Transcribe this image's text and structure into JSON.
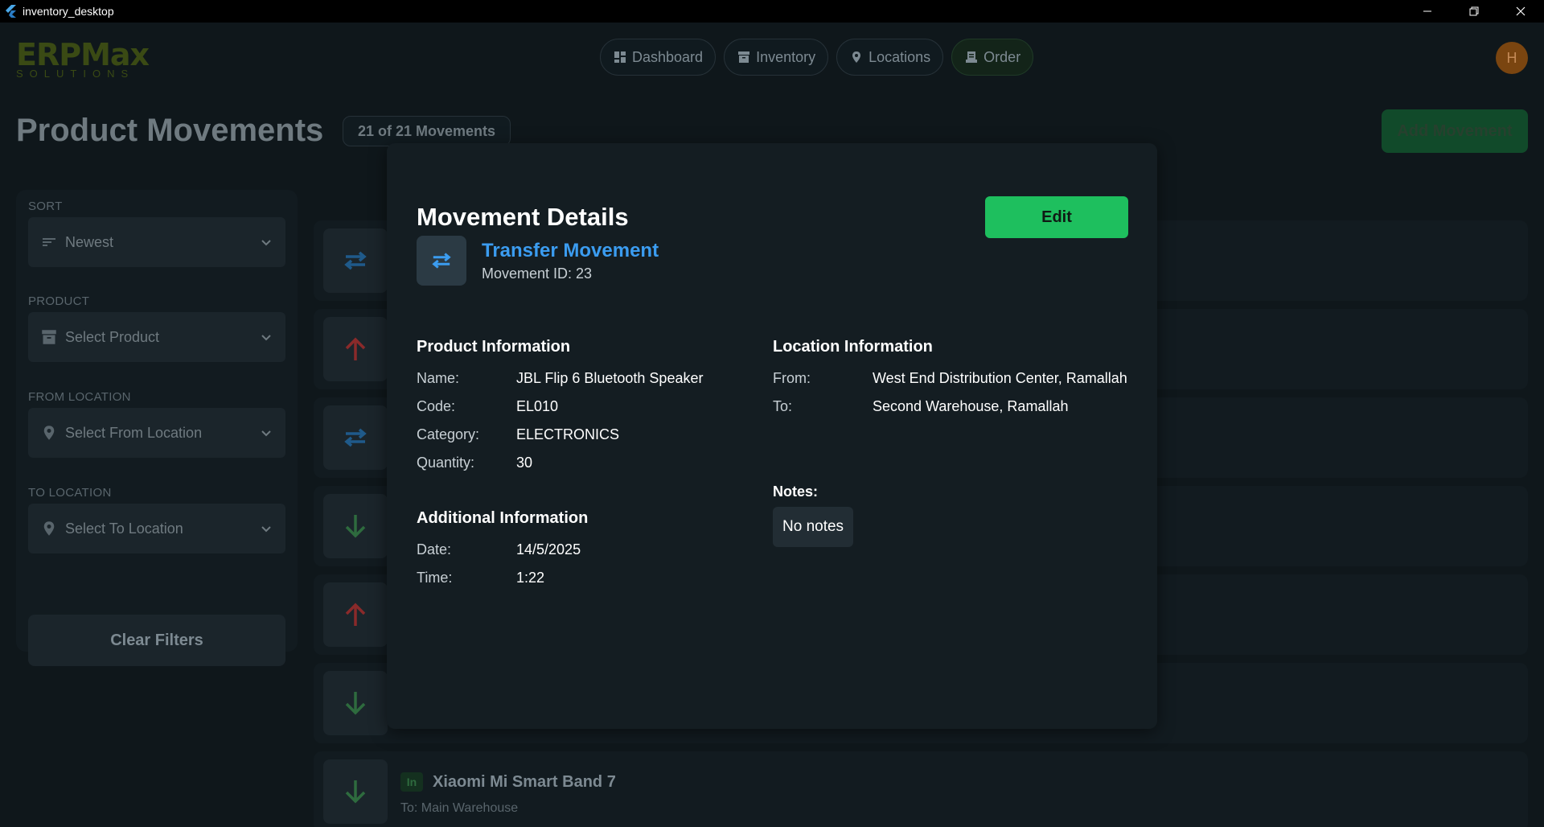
{
  "window": {
    "title": "inventory_desktop"
  },
  "logo": {
    "main": "ERPMax",
    "sub": "SOLUTIONS"
  },
  "nav": {
    "items": [
      {
        "label": "Dashboard",
        "icon": "dashboard-icon"
      },
      {
        "label": "Inventory",
        "icon": "inventory-icon"
      },
      {
        "label": "Locations",
        "icon": "location-pin-icon"
      },
      {
        "label": "Order",
        "icon": "order-icon",
        "active": true
      }
    ]
  },
  "user": {
    "initial": "H"
  },
  "page": {
    "title": "Product Movements",
    "count": "21 of 21 Movements",
    "add_label": "Add Movement"
  },
  "filters": {
    "sort": {
      "label": "SORT",
      "value": "Newest"
    },
    "product": {
      "label": "PRODUCT",
      "placeholder": "Select Product"
    },
    "from_location": {
      "label": "FROM LOCATION",
      "placeholder": "Select From Location"
    },
    "to_location": {
      "label": "TO LOCATION",
      "placeholder": "Select To Location"
    },
    "clear_label": "Clear Filters"
  },
  "movements": [
    {
      "type": "transfer"
    },
    {
      "type": "out"
    },
    {
      "type": "transfer"
    },
    {
      "type": "in"
    },
    {
      "type": "out"
    },
    {
      "type": "in"
    },
    {
      "type": "in",
      "badge": "In",
      "product": "Xiaomi Mi Smart Band 7",
      "detail": "To: Main Warehouse"
    }
  ],
  "modal": {
    "title": "Movement Details",
    "edit_label": "Edit",
    "movement_type": "Transfer Movement",
    "movement_id": "Movement ID: 23",
    "product_info": {
      "heading": "Product Information",
      "name_key": "Name:",
      "name": "JBL Flip 6 Bluetooth Speaker",
      "code_key": "Code:",
      "code": "EL010",
      "category_key": "Category:",
      "category": "ELECTRONICS",
      "quantity_key": "Quantity:",
      "quantity": "30"
    },
    "location_info": {
      "heading": "Location Information",
      "from_key": "From:",
      "from": "West End Distribution Center, Ramallah",
      "to_key": "To:",
      "to": "Second Warehouse, Ramallah"
    },
    "additional_info": {
      "heading": "Additional Information",
      "date_key": "Date:",
      "date": "14/5/2025",
      "time_key": "Time:",
      "time": "1:22"
    },
    "notes": {
      "label": "Notes:",
      "value": "No notes"
    }
  },
  "colors": {
    "transfer": "#3b9cf0",
    "transfer_dim": "#1f5a8a",
    "out_dim": "#8a2a2a",
    "in_dim": "#2e6b3e",
    "edit_button": "#1ebf5e"
  }
}
